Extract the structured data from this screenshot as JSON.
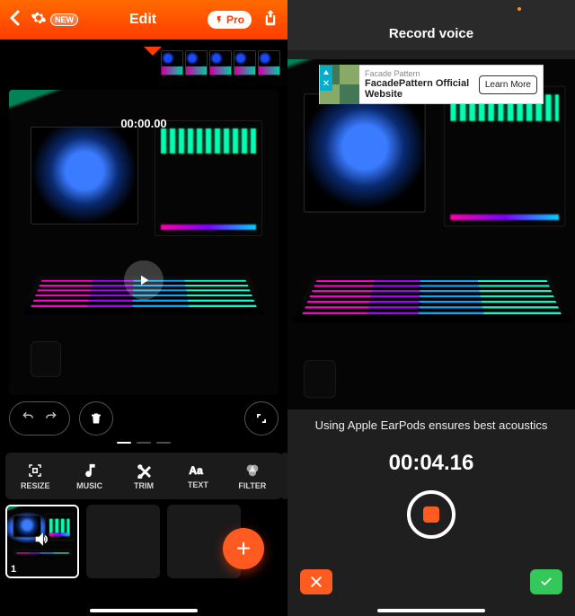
{
  "left": {
    "header": {
      "title": "Edit",
      "new_badge": "NEW",
      "pro_label": "Pro"
    },
    "preview": {
      "timecode": "00:00.00"
    },
    "tools": {
      "resize": "RESIZE",
      "music": "MUSIC",
      "trim": "TRIM",
      "text": "TEXT",
      "filter": "FILTER"
    },
    "clip": {
      "index": "1"
    },
    "fab": "+"
  },
  "right": {
    "title": "Record voice",
    "ad": {
      "category": "Facade Pattern",
      "headline": "FacadePattern Official Website",
      "cta": "Learn More"
    },
    "tip": "Using Apple EarPods ensures best acoustics",
    "timecode": "00:04.16",
    "badge_x": "✕"
  }
}
